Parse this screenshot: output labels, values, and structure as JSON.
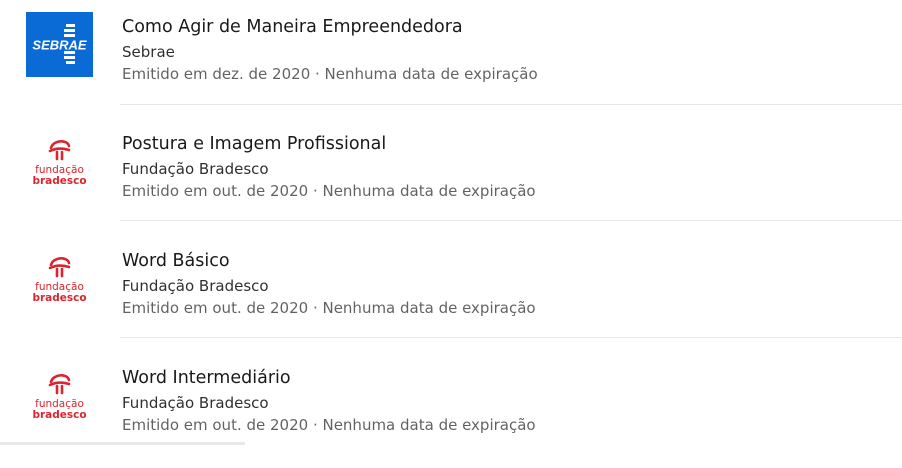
{
  "certifications": [
    {
      "title": "Como Agir de Maneira Empreendedora",
      "issuer": "Sebrae",
      "meta": "Emitido em dez. de 2020 · Nenhuma data de expiração",
      "logo": {
        "type": "sebrae",
        "text": "SEBRAE",
        "color": "#0a6ad6"
      }
    },
    {
      "title": "Postura e Imagem Profissional",
      "issuer": "Fundação Bradesco",
      "meta": "Emitido em out. de 2020 · Nenhuma data de expiração",
      "logo": {
        "type": "bradesco",
        "line1": "fundação",
        "line2": "bradesco",
        "color": "#d8262f"
      }
    },
    {
      "title": "Word Básico",
      "issuer": "Fundação Bradesco",
      "meta": "Emitido em out. de 2020 · Nenhuma data de expiração",
      "logo": {
        "type": "bradesco",
        "line1": "fundação",
        "line2": "bradesco",
        "color": "#d8262f"
      }
    },
    {
      "title": "Word Intermediário",
      "issuer": "Fundação Bradesco",
      "meta": "Emitido em out. de 2020 · Nenhuma data de expiração",
      "logo": {
        "type": "bradesco",
        "line1": "fundação",
        "line2": "bradesco",
        "color": "#d8262f"
      }
    }
  ]
}
